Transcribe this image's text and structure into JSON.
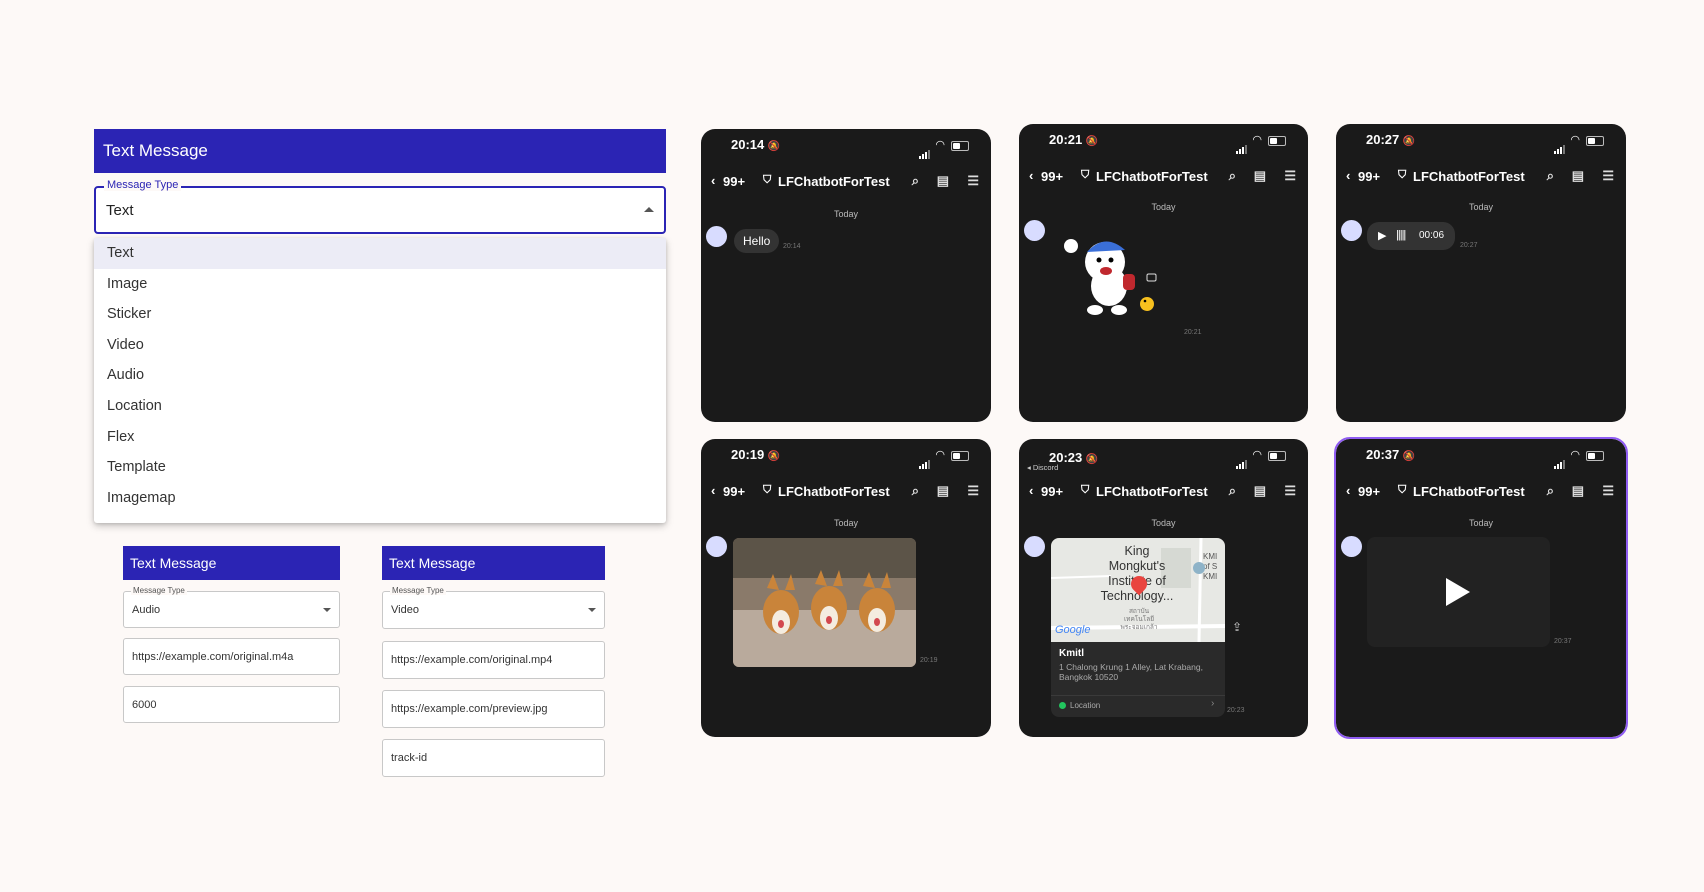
{
  "main_form": {
    "header": "Text Message",
    "select_label": "Message Type",
    "select_value": "Text",
    "options": [
      "Text",
      "Image",
      "Sticker",
      "Video",
      "Audio",
      "Location",
      "Flex",
      "Template",
      "Imagemap"
    ]
  },
  "audio_form": {
    "header": "Text Message",
    "select_label": "Message Type",
    "select_value": "Audio",
    "url": "https://example.com/original.m4a",
    "duration": "6000"
  },
  "video_form": {
    "header": "Text Message",
    "select_label": "Message Type",
    "select_value": "Video",
    "url": "https://example.com/original.mp4",
    "preview": "https://example.com/preview.jpg",
    "track_id": "track-id"
  },
  "phones": [
    {
      "time": "20:14",
      "count": "99+",
      "name": "LFChatbotForTest",
      "today": "Today",
      "message": "Hello",
      "stamp": "20:14"
    },
    {
      "time": "20:21",
      "count": "99+",
      "name": "LFChatbotForTest",
      "today": "Today",
      "stamp": "20:21"
    },
    {
      "time": "20:27",
      "count": "99+",
      "name": "LFChatbotForTest",
      "today": "Today",
      "audio_duration": "00:06",
      "stamp": "20:27"
    },
    {
      "time": "20:19",
      "count": "99+",
      "name": "LFChatbotForTest",
      "today": "Today",
      "stamp": "20:19"
    },
    {
      "time": "20:23",
      "back_app": "◂ Discord",
      "count": "99+",
      "name": "LFChatbotForTest",
      "today": "Today",
      "map_label": "King Mongkut's Institute of Technology...",
      "map_side": "KMI of S KMI",
      "map_thai": "สถาบัน เทคโนโลยี พระจอมเกล้า",
      "map_google": "Google",
      "place_name": "Kmitl",
      "place_address": "1 Chalong Krung 1 Alley, Lat Krabang, Bangkok 10520",
      "place_tag": "Location",
      "stamp": "20:23"
    },
    {
      "time": "20:37",
      "count": "99+",
      "name": "LFChatbotForTest",
      "today": "Today",
      "stamp": "20:37"
    }
  ],
  "colors": {
    "header": "#2b24b4",
    "phone_bg": "#1a1a1a",
    "selection": "#8f5cf2"
  }
}
